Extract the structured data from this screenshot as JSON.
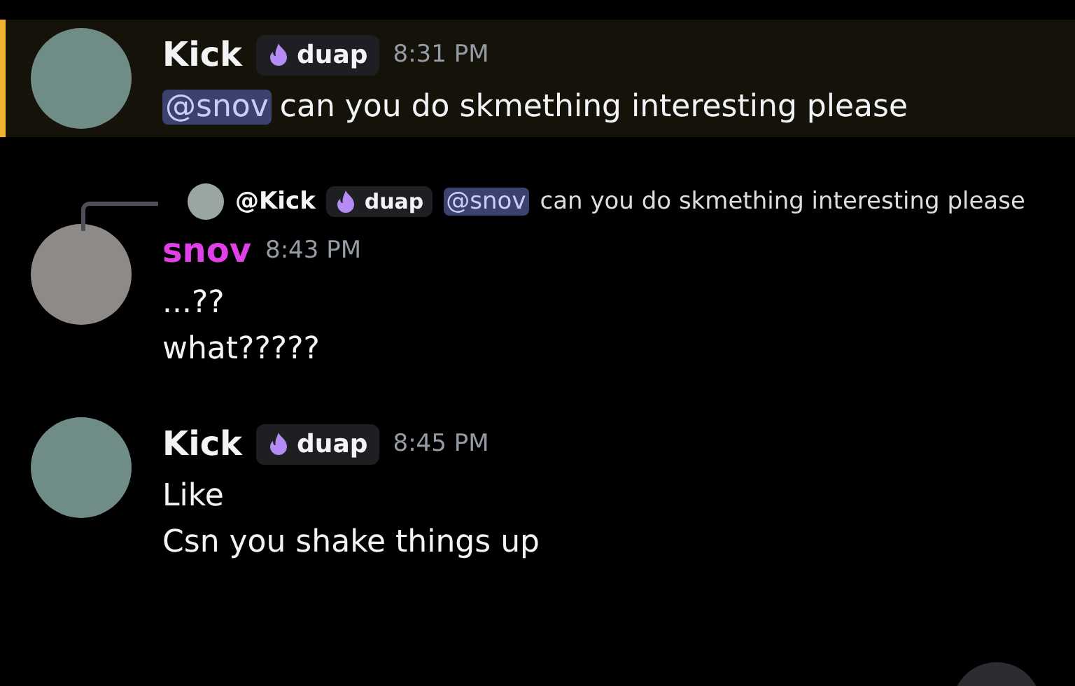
{
  "messages": [
    {
      "author": "Kick",
      "color": "#f2f3f5",
      "tag": "duap",
      "time": "8:31 PM",
      "highlighted": true,
      "lines": [
        {
          "mention": "@snov",
          "text": "can you do skmething interesting please"
        }
      ]
    },
    {
      "author": "snov",
      "color": "#e040e8",
      "time": "8:43 PM",
      "highlighted": false,
      "reply": {
        "author": "@Kick",
        "tag": "duap",
        "mention": "@snov",
        "text": "can you do skmething interesting please"
      },
      "lines": [
        {
          "text": "...??"
        },
        {
          "text": "what?????"
        }
      ]
    },
    {
      "author": "Kick",
      "color": "#f2f3f5",
      "tag": "duap",
      "time": "8:45 PM",
      "highlighted": false,
      "lines": [
        {
          "text": "Like"
        },
        {
          "text": "Csn you shake things up"
        }
      ]
    }
  ]
}
